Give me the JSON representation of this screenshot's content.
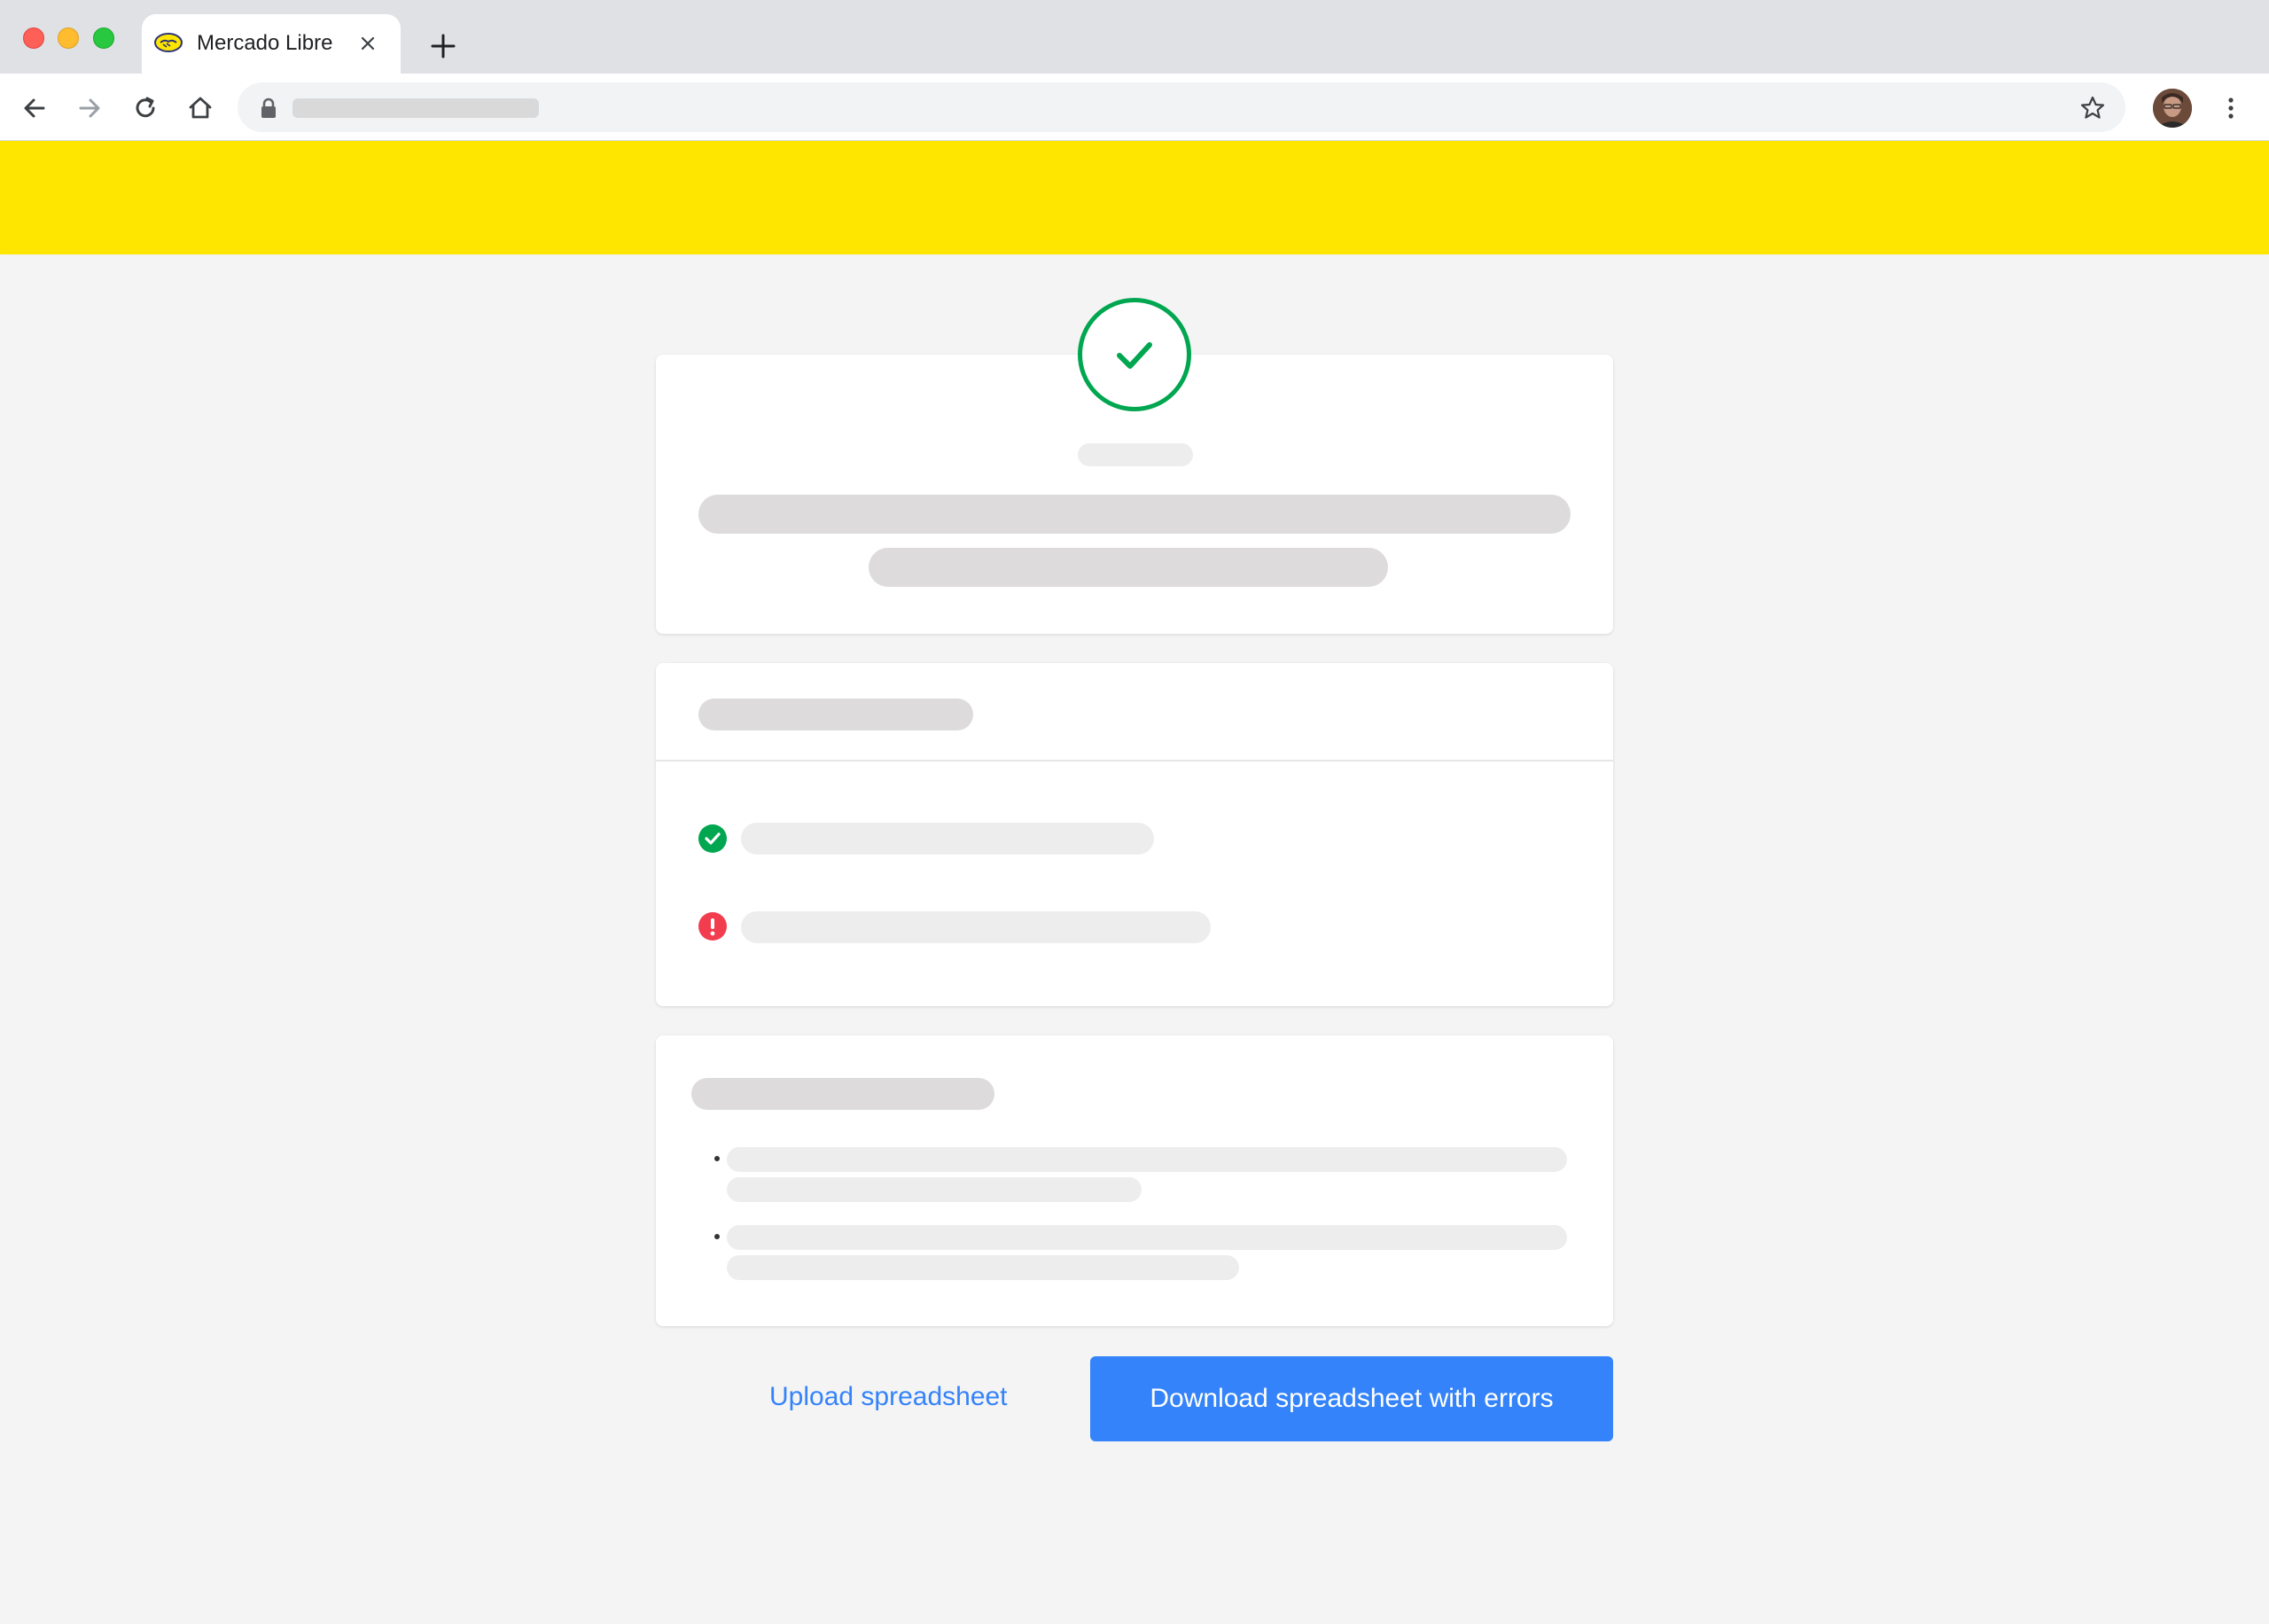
{
  "browser": {
    "tab": {
      "title": "Mercado Libre",
      "favicon": "mercado-libre-handshake-icon"
    },
    "icons": {
      "back": "arrow-left-icon",
      "forward": "arrow-right-icon",
      "reload": "reload-icon",
      "home": "home-icon",
      "lock": "lock-icon",
      "bookmark": "star-icon",
      "menu": "kebab-menu-icon",
      "new_tab": "plus-icon",
      "close_tab": "close-icon"
    }
  },
  "colors": {
    "header_yellow": "#ffe600",
    "page_background": "#f4f4f4",
    "success_green": "#00a650",
    "error_red": "#f23d4f",
    "primary_blue": "#3483fa"
  },
  "summary": {
    "status_icon": "check-circle-icon",
    "items": [
      {
        "status": "success",
        "icon": "check-circle-icon"
      },
      {
        "status": "error",
        "icon": "exclamation-circle-icon"
      }
    ]
  },
  "actions": {
    "upload_label": "Upload spreadsheet",
    "download_label": "Download spreadsheet with errors"
  }
}
